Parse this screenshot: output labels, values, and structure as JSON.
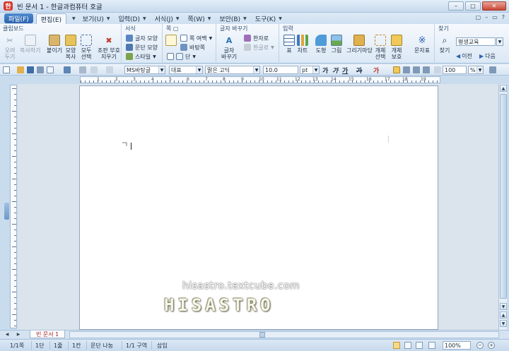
{
  "window": {
    "app_icon_glyph": "한",
    "title": "빈 문서 1 - 한글과컴퓨터 호글",
    "minimize": "–",
    "maximize": "□",
    "close": "✕"
  },
  "menu": {
    "file": "파일(F)",
    "tabs": [
      {
        "label": "편집(E)"
      },
      {
        "label": "보기(U)"
      },
      {
        "label": "입력(D)"
      },
      {
        "label": "서식(J)"
      },
      {
        "label": "쪽(W)"
      },
      {
        "label": "보안(B)"
      },
      {
        "label": "도구(K)"
      }
    ],
    "right": [
      "▢",
      "–",
      "▭",
      "?"
    ]
  },
  "ribbon": {
    "groups": {
      "clipboard": "클립보드",
      "format": "서식",
      "page": "쪽 ▢",
      "char_convert": "글자 바꾸기",
      "input": "입력",
      "find": "찾기"
    },
    "clipboard": {
      "cut": [
        "오려",
        "두기"
      ],
      "copy": "복사하기",
      "paste": "붙이기",
      "format_copy": [
        "모양",
        "복사"
      ],
      "select_all": [
        "모두",
        "선택"
      ],
      "clear": [
        "조판 부호",
        "지우기"
      ]
    },
    "format": {
      "char_shape": "글자 모양",
      "para_shape": "문단 모양",
      "style": "스타일"
    },
    "page": {
      "margin": "쪽 여백",
      "background": "바탕쪽",
      "column": "단"
    },
    "convert": {
      "char_change": [
        "글자",
        "바꾸기"
      ],
      "hanja": "한자로",
      "hangul": "한글로"
    },
    "input": {
      "table": "표",
      "chart": "차트",
      "shape": "도형",
      "picture": "그림",
      "gallery": "그리기마당",
      "select_obj": [
        "개체",
        "선택"
      ],
      "protect_obj": [
        "개체",
        "보호"
      ],
      "symbol": "문자표"
    },
    "find": {
      "find": "찾기",
      "search_value": "평생교육",
      "prev": "이전",
      "next": "다음"
    }
  },
  "toolbar": {
    "font_lang": "MS바탕글",
    "style": "대표",
    "font": "맑은 고딕",
    "size": "10.0",
    "unit": "pt",
    "bold": "가",
    "italic": "가",
    "underline": "가",
    "strike": "가",
    "color": "가",
    "zoom": "100",
    "zoom_unit": "%"
  },
  "ruler": {
    "marks": [
      "1",
      "2",
      "3",
      "4",
      "5",
      "6",
      "7",
      "8",
      "9",
      "10",
      "11",
      "12",
      "13",
      "14",
      "15",
      "16",
      "17",
      "18",
      "19"
    ]
  },
  "watermark": {
    "url": "hisastro.textcube.com",
    "logo": "HISASTRO"
  },
  "doc_tabs": {
    "prev": "◀",
    "next": "▶",
    "current": "빈 문서 1"
  },
  "status": {
    "page": "1/1쪽",
    "section": "1단",
    "line": "1줄",
    "column": "1칸",
    "para_break": "문단 나눔",
    "region": "1/1 구역",
    "mode": "삽입",
    "zoom": "100%",
    "zoom_out": "−",
    "zoom_in": "+"
  },
  "colors": {
    "accent": "#2d63ad",
    "title_bg": "#c6daee",
    "ribbon_bg": "#dbe8f5",
    "close_red": "#c84634"
  }
}
